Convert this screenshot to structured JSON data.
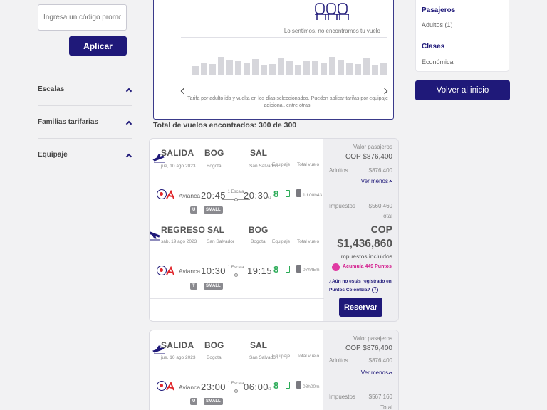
{
  "promo": {
    "placeholder": "Ingresa un código promocional",
    "apply_label": "Aplicar"
  },
  "filters": [
    {
      "label": "Escalas"
    },
    {
      "label": "Familias tarifarias"
    },
    {
      "label": "Equipaje"
    }
  ],
  "calendar": {
    "not_found": "Lo sentimos, no encontramos tu vuelo",
    "note": "Tarifa por adulto ida y vuelta en los días seleccionados. Pueden aplicar tarifas por equipaje adicional, entre otras."
  },
  "results_total": "Total de vuelos encontrados: 300 de 300",
  "sidebar": {
    "passengers_title": "Pasajeros",
    "passengers_value": "Adultos (1)",
    "class_title": "Clases",
    "class_value": "Económica",
    "home_button": "Volver al inicio"
  },
  "flights": [
    {
      "outbound": {
        "title": "SALIDA",
        "from": "BOG",
        "to": "SAL",
        "date": "jue, 10 ago 2023",
        "from_city": "Bogota",
        "to_city": "San Salvador",
        "baggage_label": "Equipaje",
        "total_label": "Total vuelo",
        "airline": "Avianca",
        "depart": "20:45",
        "stops": "1 Escala",
        "arrive": "20:30",
        "plus_day": "+1",
        "duration": "1d 00h43",
        "fare_code": "U",
        "fare_size": "SMALL"
      },
      "return": {
        "title": "REGRESO",
        "from": "SAL",
        "to": "BOG",
        "date": "sáb, 19 ago 2023",
        "from_city": "San Salvador",
        "to_city": "Bogota",
        "baggage_label": "Equipaje",
        "total_label": "Total vuelo",
        "airline": "Avianca",
        "depart": "10:30",
        "stops": "1 Escala",
        "arrive": "19:15",
        "plus_day": "",
        "duration": "07h45m",
        "fare_code": "T",
        "fare_size": "SMALL"
      },
      "price": {
        "passengers_label": "Valor pasajeros",
        "passengers_amount": "COP $876,400",
        "adults_label": "Adultos",
        "adults_amount": "$876,400",
        "see_less": "Ver menos",
        "taxes_label": "Impuestos",
        "taxes_amount": "$560,460",
        "total_label": "Total",
        "currency": "COP",
        "total_amount": "$1,436,860",
        "taxes_included": "Impuestos incluidos",
        "points": "Acumula 449 Puntos",
        "register_q": "¿Aún no estás registrado en Puntos Colombia?",
        "reserve_label": "Reservar"
      }
    },
    {
      "outbound": {
        "title": "SALIDA",
        "from": "BOG",
        "to": "SAL",
        "date": "jue, 10 ago 2023",
        "from_city": "Bogota",
        "to_city": "San Salvador",
        "baggage_label": "Equipaje",
        "total_label": "Total vuelo",
        "airline": "Avianca",
        "depart": "23:00",
        "stops": "1 Escala",
        "arrive": "06:00",
        "plus_day": "+1",
        "duration": "08h00m",
        "fare_code": "U",
        "fare_size": "SMALL"
      },
      "price": {
        "passengers_label": "Valor pasajeros",
        "passengers_amount": "COP $876,400",
        "adults_label": "Adultos",
        "adults_amount": "$876,400",
        "see_less": "Ver menos",
        "taxes_label": "Impuestos",
        "taxes_amount": "$567,160",
        "total_label": "Total"
      }
    }
  ],
  "colors": {
    "brand": "#1f1979",
    "baggage_green": "#2bab57",
    "points_pink": "#d31a8c",
    "airline_red": "#e0262b"
  }
}
